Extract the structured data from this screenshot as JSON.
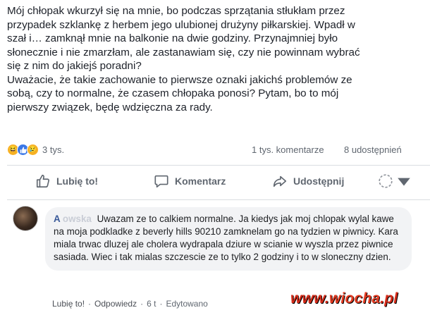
{
  "post": {
    "text_p1": "Mój chłopak wkurzył się na mnie, bo podczas sprzątania stłukłam przez\nprzypadek szklankę z herbem jego ulubionej drużyny piłkarskiej. Wpadł w\nszał i… zamknął mnie na balkonie na dwie godziny. Przynajmniej było\nsłonecznie i nie zmarzłam, ale zastanawiam się, czy nie powinnam wybrać\nsię z nim do jakiejś poradni?",
    "text_p2": "Uważacie, że takie zachowanie to pierwsze oznaki jakichś problemów ze\nsobą, czy to normalne, że czasem chłopaka ponosi? Pytam, bo to mój\npierwszy związek, będę wdzięczna za rady."
  },
  "stats": {
    "reactions_count": "3 tys.",
    "comments": "1 tys. komentarze",
    "shares": "8 udostępnień"
  },
  "actions": {
    "like": "Lubię to!",
    "comment": "Komentarz",
    "share": "Udostępnij"
  },
  "comment": {
    "author_visible": "A",
    "author_blurred": "             owska",
    "text": "Uwazam ze to calkiem normalne. Ja kiedys jak moj chlopak wylal kawe na moja podkladke z beverly hills 90210 zamknelam go na tydzien w piwnicy. Kara miala trwac dluzej ale cholera wydrapala dziure w scianie w wyszla przez piwnice sasiada. Wiec i tak mialas szczescie ze to tylko 2 godziny i to w sloneczny dzien.",
    "like": "Lubię to!",
    "reply": "Odpowiedz",
    "time": "6 t",
    "edited": "Edytowano",
    "separator": "·"
  },
  "watermark": {
    "part1": "www.",
    "part2": "wiocha",
    "part3": ".pl"
  },
  "colors": {
    "link": "#385898",
    "muted": "#606770",
    "bubble": "#f2f3f5",
    "watermark": "#d62c1a"
  }
}
